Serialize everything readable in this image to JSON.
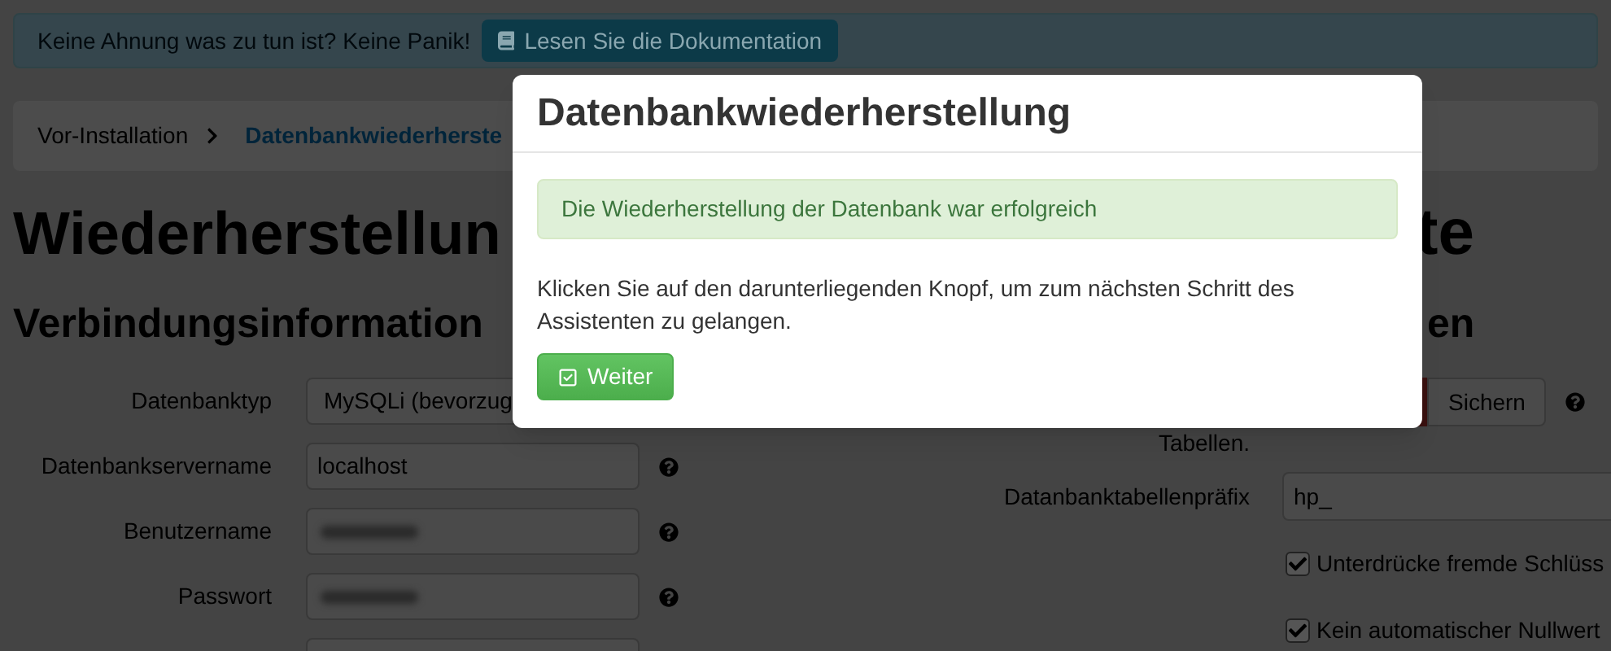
{
  "help_banner": {
    "text": "Keine Ahnung was zu tun ist? Keine Panik!",
    "button": "Lesen Sie die Dokumentation"
  },
  "breadcrumb": [
    {
      "label": "Vor-Installation",
      "selected": false
    },
    {
      "label": "Datenbankwiederherste",
      "selected": true
    }
  ],
  "page_title": {
    "left": "Wiederherstellun",
    "right": "te"
  },
  "connection_section": {
    "heading": "Verbindungsinformation",
    "fields": [
      {
        "kind": "select",
        "label": "Datenbanktyp",
        "value": "MySQLi (bevorzug"
      },
      {
        "kind": "text",
        "label": "Datenbankservername",
        "value": "localhost",
        "help": true
      },
      {
        "kind": "redacted",
        "label": "Benutzername",
        "help": true
      },
      {
        "kind": "redacted",
        "label": "Passwort",
        "help": true
      },
      {
        "kind": "text"
      }
    ]
  },
  "options_section": {
    "heading": "en",
    "backup": {
      "label": "Tabellen.",
      "button": "Sichern",
      "help": true
    },
    "prefix": {
      "label": "Datanbanktabellenpräfix",
      "value": "hp_"
    },
    "checkboxes": [
      {
        "label": "Unterdrücke fremde Schlüss",
        "checked": true
      },
      {
        "label": "Kein automatischer Nullwert",
        "checked": true
      }
    ]
  },
  "dialog": {
    "title": "Datenbankwiederherstellung",
    "message": "Die Wiederherstellung der Datenbank war erfolgreich",
    "text": "Klicken Sie auf den darunterliegenden Knopf, um zum nächsten Schritt des Assistenten zu gelangen.",
    "button": "Weiter"
  }
}
